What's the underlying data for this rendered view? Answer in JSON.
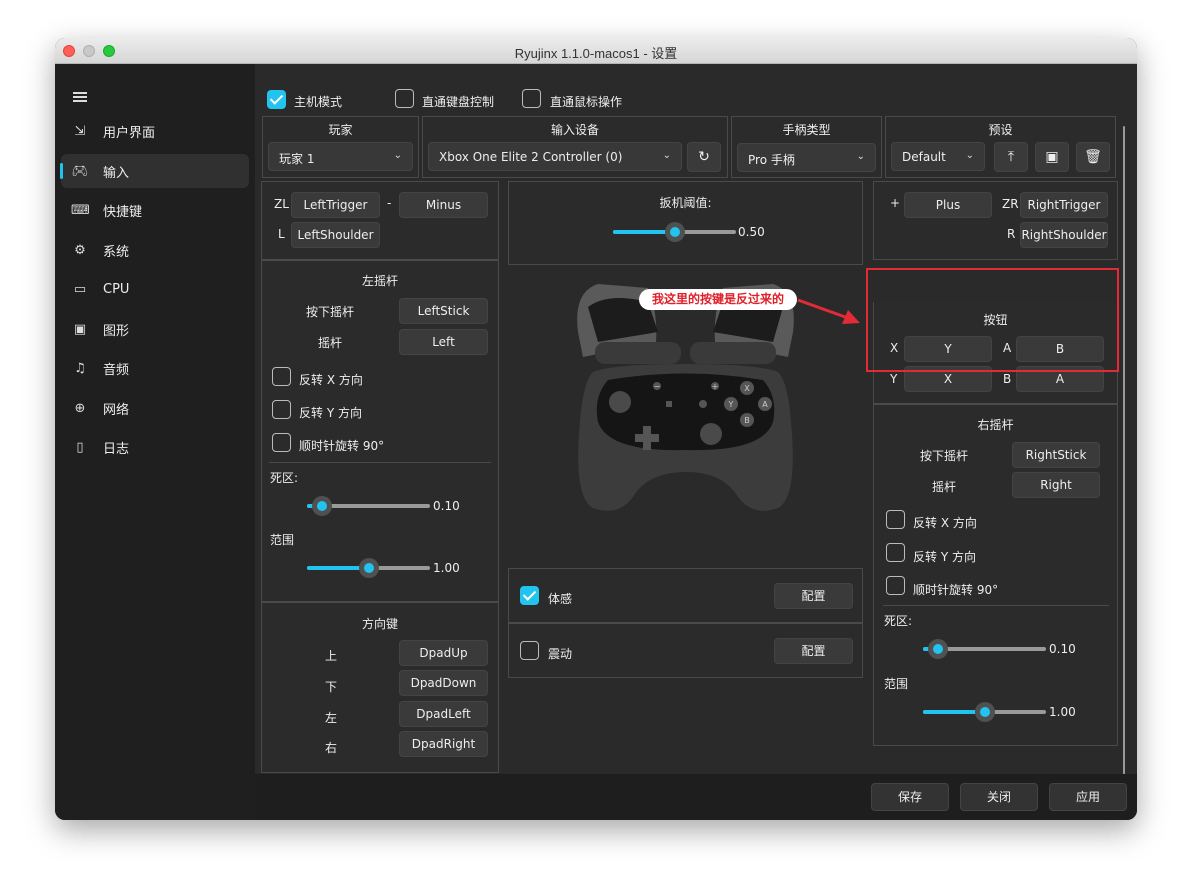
{
  "window": {
    "title": "Ryujinx  1.1.0-macos1 - 设置"
  },
  "sidebar": {
    "items": [
      {
        "label": "用户界面",
        "icon": "ui-icon"
      },
      {
        "label": "输入",
        "icon": "gamepad-icon",
        "selected": true
      },
      {
        "label": "快捷键",
        "icon": "keyboard-icon"
      },
      {
        "label": "系统",
        "icon": "gear-icon"
      },
      {
        "label": "CPU",
        "icon": "cpu-icon"
      },
      {
        "label": "图形",
        "icon": "image-icon"
      },
      {
        "label": "音频",
        "icon": "music-icon"
      },
      {
        "label": "网络",
        "icon": "globe-icon"
      },
      {
        "label": "日志",
        "icon": "file-icon"
      }
    ]
  },
  "top_checks": {
    "host_mode": "主机模式",
    "direct_keyboard": "直通键盘控制",
    "direct_mouse": "直通鼠标操作"
  },
  "player": {
    "header": "玩家",
    "value": "玩家 1"
  },
  "input_device": {
    "header": "输入设备",
    "value": "Xbox One Elite 2 Controller (0)"
  },
  "controller_type": {
    "header": "手柄类型",
    "value": "Pro 手柄"
  },
  "preset": {
    "header": "预设",
    "value": "Default"
  },
  "shoulder_left": {
    "zl_label": "ZL",
    "zl_value": "LeftTrigger",
    "minus_label": "-",
    "minus_value": "Minus",
    "l_label": "L",
    "l_value": "LeftShoulder"
  },
  "shoulder_right": {
    "plus_label": "+",
    "plus_value": "Plus",
    "zr_label": "ZR",
    "zr_value": "RightTrigger",
    "r_label": "R",
    "r_value": "RightShoulder"
  },
  "trigger_threshold": {
    "label": "扳机阈值:",
    "value": "0.50",
    "level": 0.5
  },
  "left_stick": {
    "header": "左摇杆",
    "press_label": "按下摇杆",
    "press_value": "LeftStick",
    "stick_label": "摇杆",
    "stick_value": "Left",
    "invert_x": "反转 X 方向",
    "invert_y": "反转 Y 方向",
    "rotate": "顺时针旋转 90°",
    "deadzone_label": "死区:",
    "deadzone_value": "0.10",
    "deadzone_level": 0.1,
    "range_label": "范围",
    "range_value": "1.00",
    "range_level": 0.5
  },
  "dpad": {
    "header": "方向键",
    "rows": [
      {
        "label": "上",
        "value": "DpadUp"
      },
      {
        "label": "下",
        "value": "DpadDown"
      },
      {
        "label": "左",
        "value": "DpadLeft"
      },
      {
        "label": "右",
        "value": "DpadRight"
      }
    ]
  },
  "buttons": {
    "header": "按钮",
    "x_label": "X",
    "x_value": "Y",
    "a_label": "A",
    "a_value": "B",
    "y_label": "Y",
    "y_value": "X",
    "b_label": "B",
    "b_value": "A"
  },
  "right_stick": {
    "header": "右摇杆",
    "press_label": "按下摇杆",
    "press_value": "RightStick",
    "stick_label": "摇杆",
    "stick_value": "Right",
    "invert_x": "反转 X 方向",
    "invert_y": "反转 Y 方向",
    "rotate": "顺时针旋转 90°",
    "deadzone_label": "死区:",
    "deadzone_value": "0.10",
    "deadzone_level": 0.1,
    "range_label": "范围",
    "range_value": "1.00",
    "range_level": 0.5
  },
  "motion": {
    "label": "体感",
    "config": "配置"
  },
  "rumble": {
    "label": "震动",
    "config": "配置"
  },
  "controller_glyphs": {
    "minus": "−",
    "plus": "+",
    "x": "X",
    "y": "Y",
    "a": "A",
    "b": "B"
  },
  "annotation": "我这里的按键是反过来的",
  "footer": {
    "save": "保存",
    "close": "关闭",
    "apply": "应用"
  },
  "colors": {
    "accent": "#22c3ee",
    "annotation_red": "#e32b38"
  }
}
